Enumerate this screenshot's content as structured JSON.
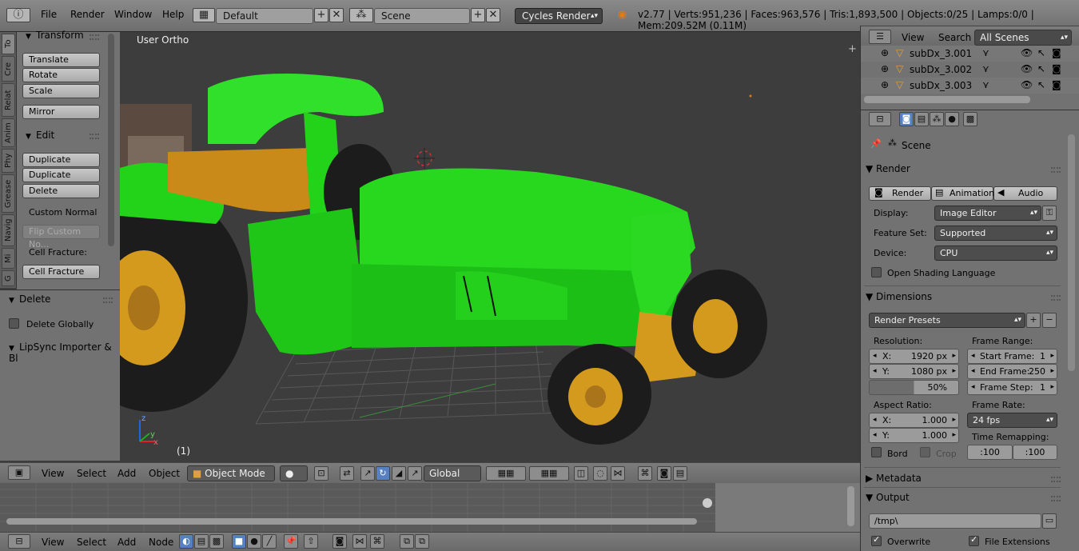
{
  "topbar": {
    "menus": [
      "File",
      "Render",
      "Window",
      "Help"
    ],
    "layout": "Default",
    "scene": "Scene",
    "engine": "Cycles Render",
    "stats": "v2.77 | Verts:951,236 | Faces:963,576 | Tris:1,893,500 | Objects:0/25 | Lamps:0/0 | Mem:209.52M (0.11M)"
  },
  "tabs": [
    "To",
    "Cre",
    "Relat",
    "Anim",
    "Phy",
    "Grease",
    "Navig",
    "Mi",
    "G"
  ],
  "toolshelf": {
    "transform_title": "Transform",
    "translate": "Translate",
    "rotate": "Rotate",
    "scale": "Scale",
    "mirror": "Mirror",
    "edit_title": "Edit",
    "duplicate": "Duplicate",
    "duplicate_linked": "Duplicate Linked",
    "delete": "Delete",
    "custom_normal": "Custom Normal",
    "flip_custom": "Flip Custom No...",
    "cell_fracture_label": "Cell Fracture:",
    "cell_fracture": "Cell Fracture"
  },
  "redo": {
    "title": "Delete",
    "delete_globally": "Delete Globally",
    "lipsync": "LipSync Importer & Bl"
  },
  "viewport": {
    "view_name": "User Ortho",
    "frame": "(1)"
  },
  "viewheader": {
    "menus": [
      "View",
      "Select",
      "Add",
      "Object"
    ],
    "mode": "Object Mode",
    "orientation": "Global"
  },
  "timeline_header": {
    "menus": [
      "View",
      "Select",
      "Add",
      "Node"
    ]
  },
  "outliner": {
    "menus": [
      "View",
      "Search"
    ],
    "filter": "All Scenes",
    "items": [
      "subDx_3.001",
      "subDx_3.002",
      "subDx_3.003"
    ]
  },
  "properties": {
    "context": "Scene",
    "render_title": "Render",
    "render_btn": "Render",
    "animation_btn": "Animation",
    "audio_btn": "Audio",
    "display_label": "Display:",
    "display_value": "Image Editor",
    "feature_label": "Feature Set:",
    "feature_value": "Supported",
    "device_label": "Device:",
    "device_value": "CPU",
    "osl": "Open Shading Language",
    "dimensions_title": "Dimensions",
    "presets": "Render Presets",
    "resolution_label": "Resolution:",
    "res_x_label": "X:",
    "res_x": "1920 px",
    "res_y_label": "Y:",
    "res_y": "1080 px",
    "res_pct": "50%",
    "frame_range_label": "Frame Range:",
    "start_label": "Start Frame:",
    "start": "1",
    "end_label": "End Frame:",
    "end": "250",
    "step_label": "Frame Step:",
    "step": "1",
    "aspect_label": "Aspect Ratio:",
    "asp_x_label": "X:",
    "asp_x": "1.000",
    "asp_y_label": "Y:",
    "asp_y": "1.000",
    "frame_rate_label": "Frame Rate:",
    "fps": "24 fps",
    "remap_label": "Time Remapping:",
    "remap_old": ":100",
    "remap_new": ":100",
    "border": "Bord",
    "crop": "Crop",
    "metadata_title": "Metadata",
    "output_title": "Output",
    "output_path": "/tmp\\",
    "overwrite": "Overwrite",
    "file_ext": "File Extensions"
  },
  "colors": {
    "body_green": "#22d31a",
    "rim_orange": "#d49a1e",
    "tire": "#1c1c1c",
    "grid": "#555555",
    "active_button": "#5680c2"
  }
}
